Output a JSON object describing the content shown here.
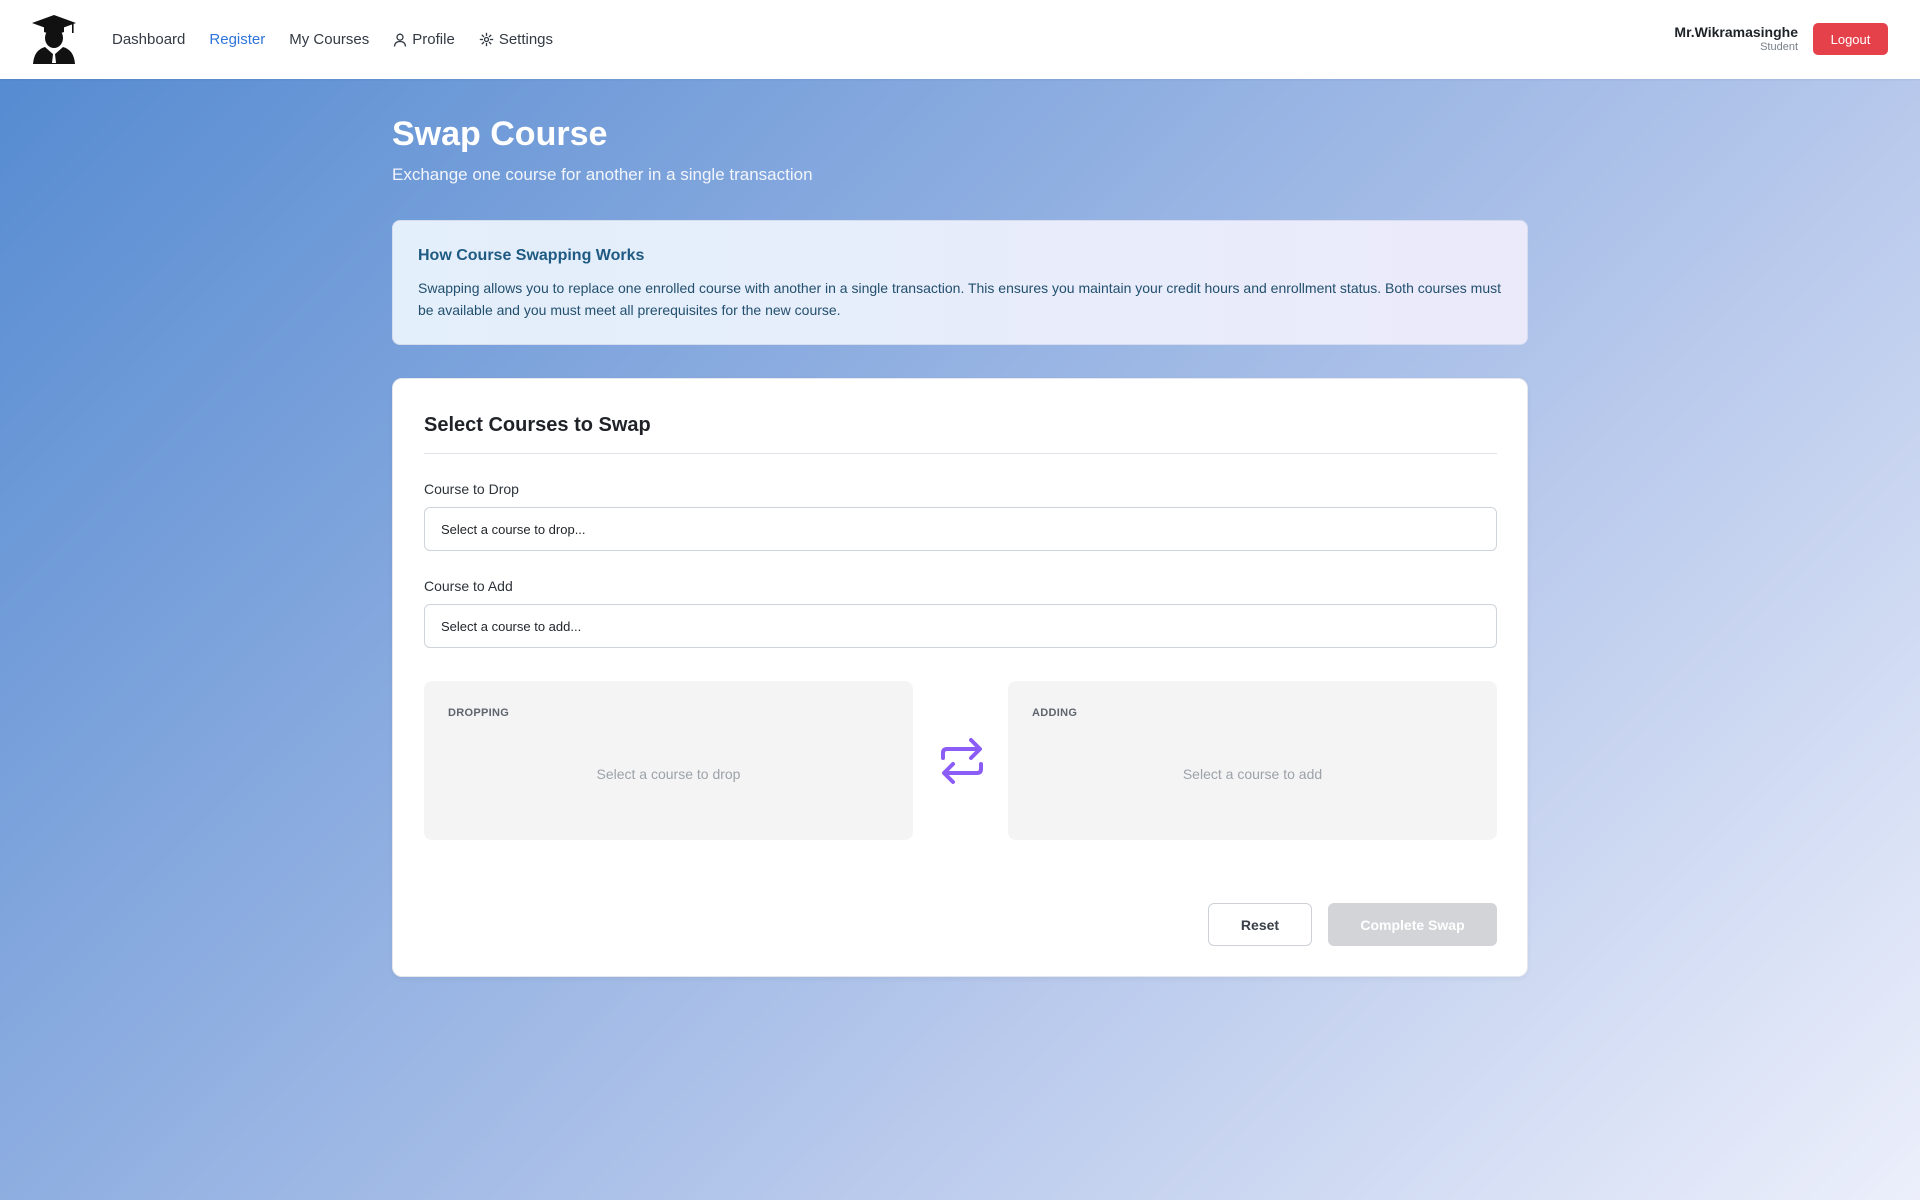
{
  "nav": {
    "items": [
      {
        "label": "Dashboard",
        "active": false
      },
      {
        "label": "Register",
        "active": true
      },
      {
        "label": "My Courses",
        "active": false
      },
      {
        "label": "Profile",
        "icon": "user-icon",
        "active": false
      },
      {
        "label": "Settings",
        "icon": "settings-icon",
        "active": false
      }
    ]
  },
  "user": {
    "name": "Mr.Wikramasinghe",
    "role": "Student"
  },
  "logout_label": "Logout",
  "page": {
    "title": "Swap Course",
    "subtitle": "Exchange one course for another in a single transaction"
  },
  "info": {
    "title": "How Course Swapping Works",
    "text": "Swapping allows you to replace one enrolled course with another in a single transaction. This ensures you maintain your credit hours and enrollment status. Both courses must be available and you must meet all prerequisites for the new course."
  },
  "form": {
    "title": "Select Courses to Swap",
    "drop_label": "Course to Drop",
    "drop_value": "Select a course to drop...",
    "add_label": "Course to Add",
    "add_value": "Select a course to add..."
  },
  "panels": {
    "dropping": {
      "label": "DROPPING",
      "empty": "Select a course to drop"
    },
    "adding": {
      "label": "ADDING",
      "empty": "Select a course to add"
    }
  },
  "actions": {
    "reset_label": "Reset",
    "complete_label": "Complete Swap",
    "complete_enabled": false
  },
  "colors": {
    "accent": "#2f74d9",
    "logout": "#e5414b",
    "swap_icon": "#8b5cf6",
    "disabled_button": "#d2d4d7"
  }
}
